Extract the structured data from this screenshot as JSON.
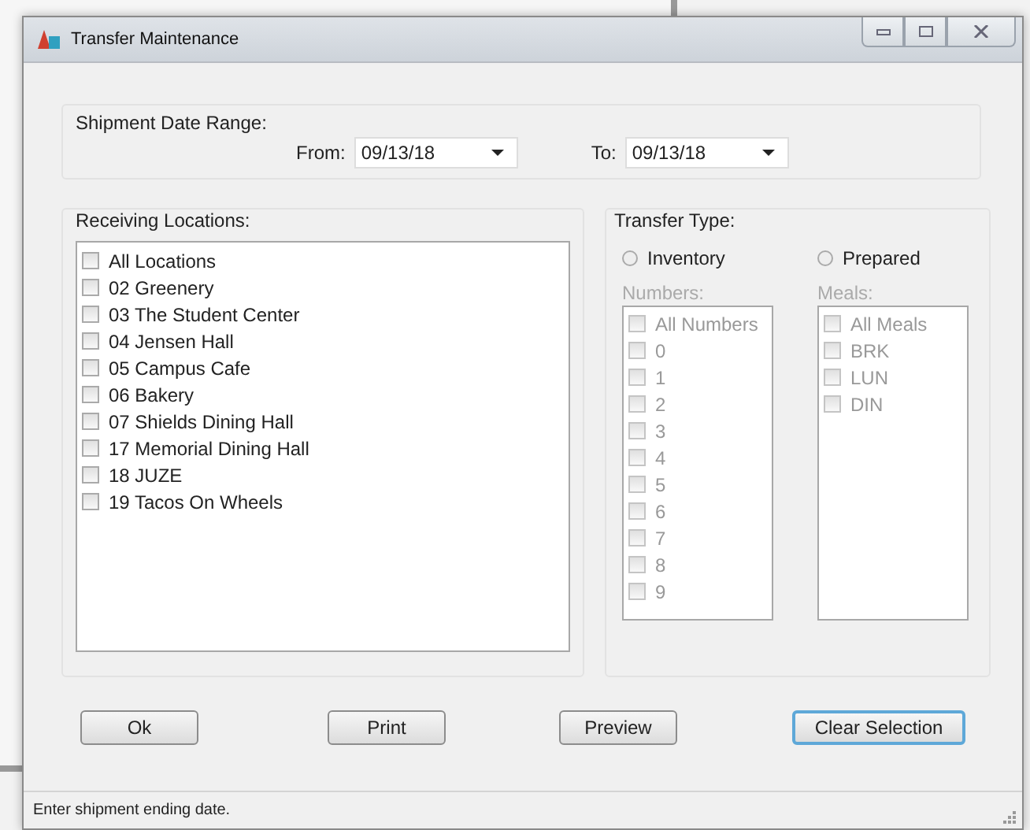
{
  "window": {
    "title": "Transfer Maintenance"
  },
  "date_range": {
    "label": "Shipment Date Range:",
    "from": {
      "label": "From:",
      "value": "09/13/18"
    },
    "to": {
      "label": "To:",
      "value": "09/13/18"
    }
  },
  "receiving_locations": {
    "label": "Receiving Locations:",
    "items": [
      {
        "label": "All Locations",
        "checked": false
      },
      {
        "label": "02 Greenery",
        "checked": false
      },
      {
        "label": "03 The Student Center",
        "checked": false
      },
      {
        "label": "04 Jensen Hall",
        "checked": false
      },
      {
        "label": "05 Campus Cafe",
        "checked": false
      },
      {
        "label": "06 Bakery",
        "checked": false
      },
      {
        "label": "07 Shields Dining Hall",
        "checked": false
      },
      {
        "label": "17 Memorial Dining Hall",
        "checked": false
      },
      {
        "label": "18 JUZE",
        "checked": false
      },
      {
        "label": "19 Tacos On Wheels",
        "checked": false
      }
    ]
  },
  "transfer_type": {
    "label": "Transfer Type:",
    "options": [
      {
        "label": "Inventory",
        "selected": false,
        "list_label": "Numbers:",
        "disabled": true,
        "items": [
          {
            "label": "All Numbers",
            "checked": false
          },
          {
            "label": "0",
            "checked": false
          },
          {
            "label": "1",
            "checked": false
          },
          {
            "label": "2",
            "checked": false
          },
          {
            "label": "3",
            "checked": false
          },
          {
            "label": "4",
            "checked": false
          },
          {
            "label": "5",
            "checked": false
          },
          {
            "label": "6",
            "checked": false
          },
          {
            "label": "7",
            "checked": false
          },
          {
            "label": "8",
            "checked": false
          },
          {
            "label": "9",
            "checked": false
          }
        ]
      },
      {
        "label": "Prepared",
        "selected": false,
        "list_label": "Meals:",
        "disabled": true,
        "items": [
          {
            "label": "All Meals",
            "checked": false
          },
          {
            "label": "BRK",
            "checked": false
          },
          {
            "label": "LUN",
            "checked": false
          },
          {
            "label": "DIN",
            "checked": false
          }
        ]
      }
    ]
  },
  "buttons": [
    {
      "label": "Ok",
      "focused": false
    },
    {
      "label": "Print",
      "focused": false
    },
    {
      "label": "Preview",
      "focused": false
    },
    {
      "label": "Clear Selection",
      "focused": true
    }
  ],
  "status_bar": "Enter shipment ending date."
}
